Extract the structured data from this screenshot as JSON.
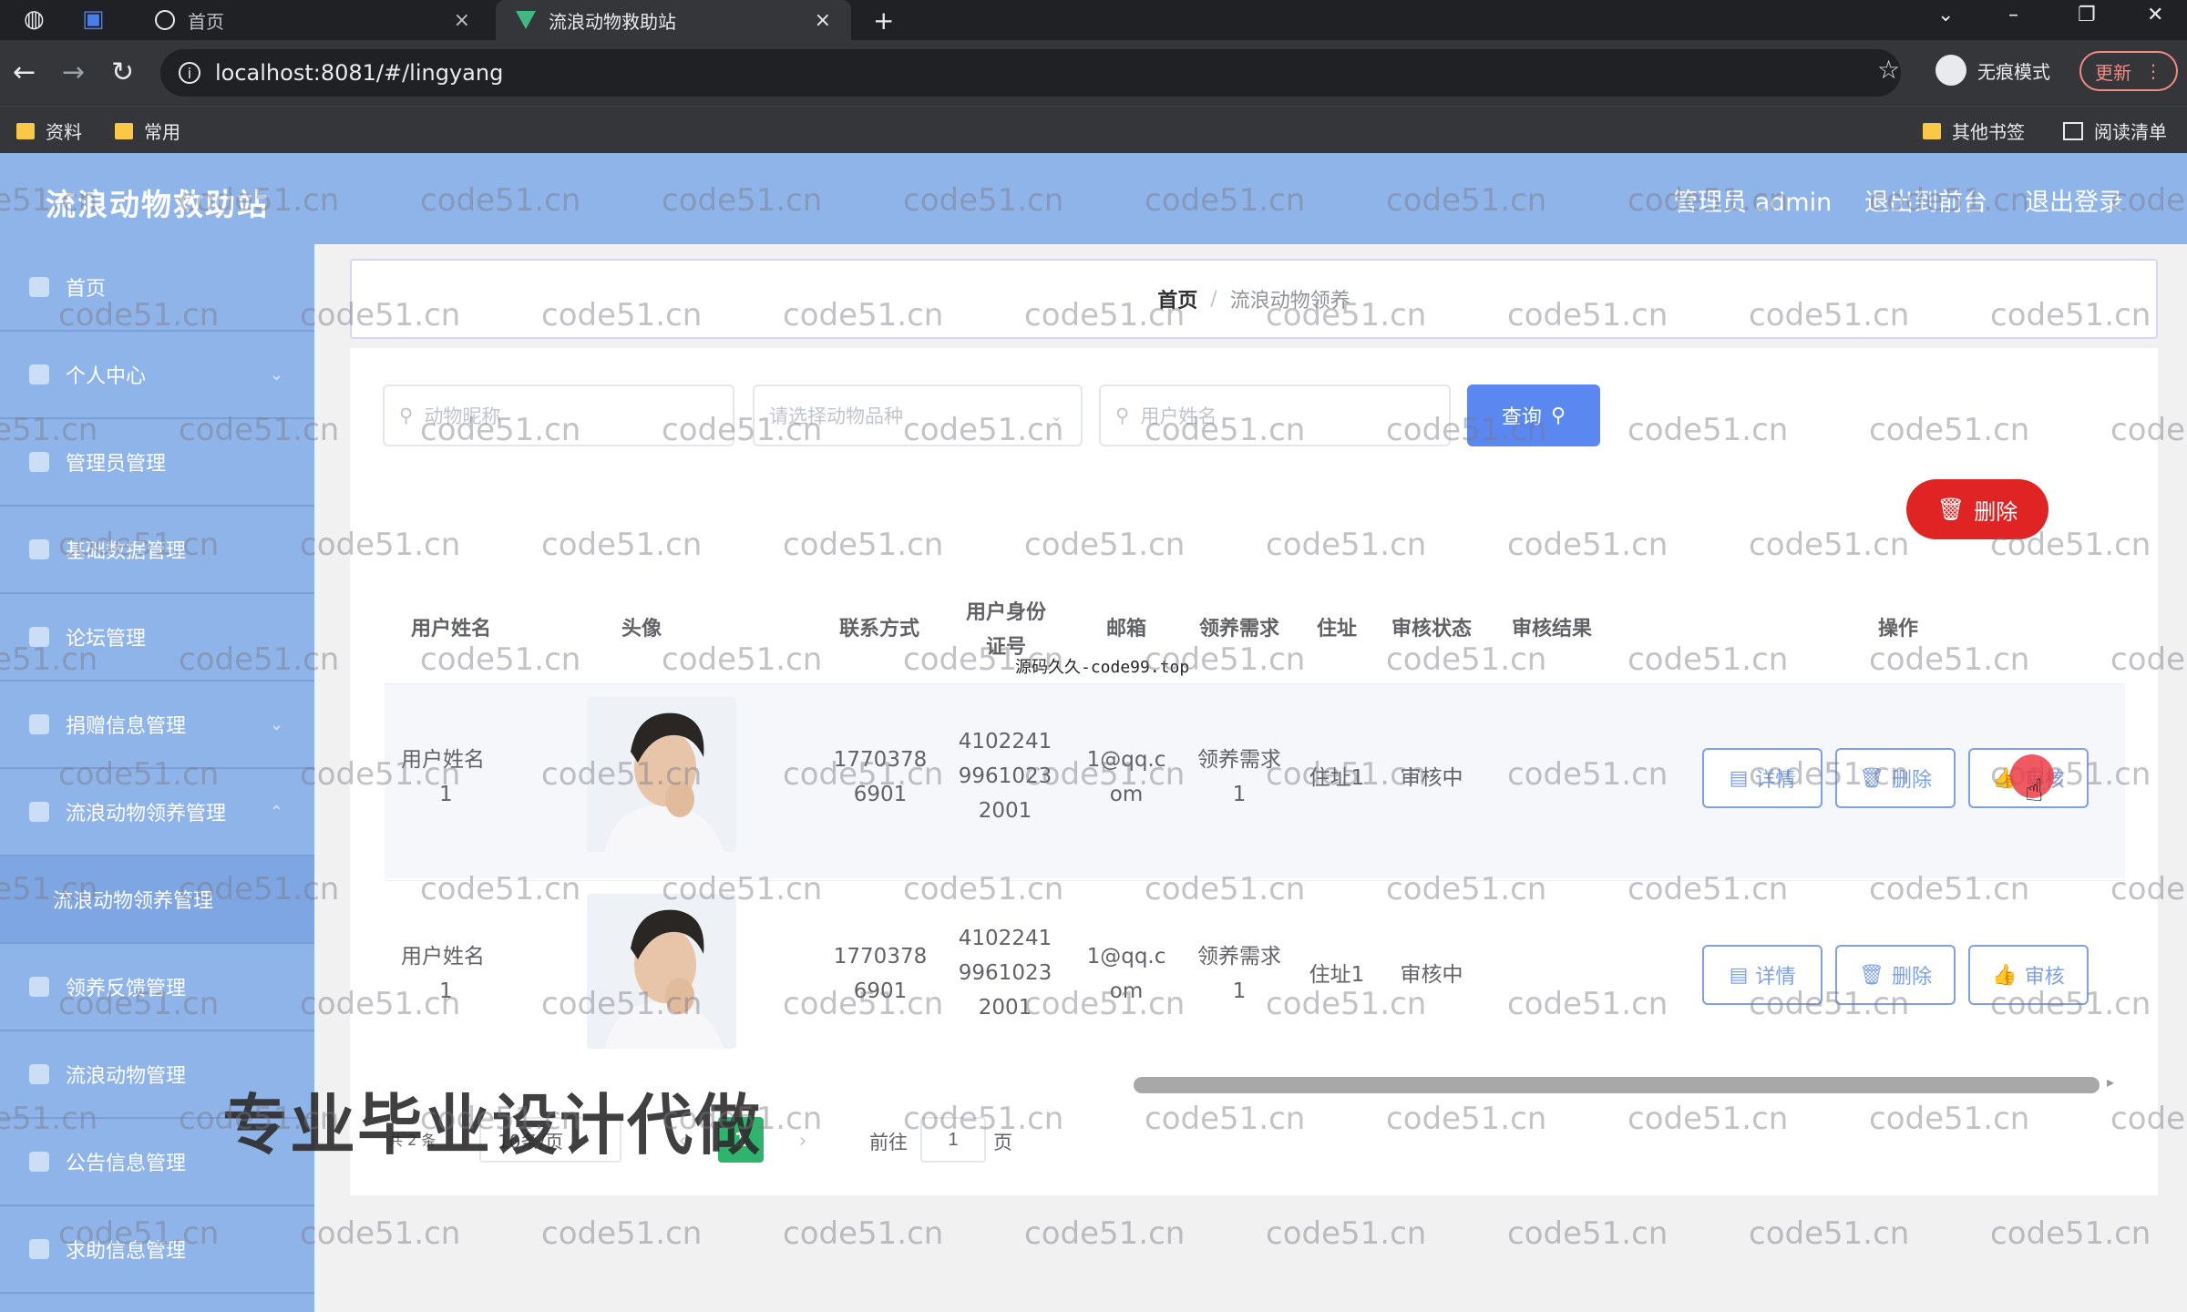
{
  "browser": {
    "tabs": [
      {
        "label": "首页"
      },
      {
        "label": "流浪动物救助站"
      }
    ],
    "close_glyph": "×",
    "new_tab_glyph": "+",
    "url": "localhost:8081/#/lingyang",
    "incognito_label": "无痕模式",
    "update_label": "更新",
    "bookmarks": [
      "资料",
      "常用"
    ],
    "bookmarks_right": [
      "其他书签",
      "阅读清单"
    ]
  },
  "header": {
    "brand": "流浪动物救助站",
    "admin_label": "管理员 admin",
    "exit_frontend": "退出到前台",
    "logout": "退出登录"
  },
  "sidebar": {
    "items": [
      {
        "label": "首页",
        "icon": "home-icon"
      },
      {
        "label": "个人中心",
        "icon": "user-icon"
      },
      {
        "label": "管理员管理",
        "icon": "admin-icon"
      },
      {
        "label": "基础数据管理",
        "icon": "list-icon"
      },
      {
        "label": "论坛管理",
        "icon": "forum-icon"
      },
      {
        "label": "捐赠信息管理",
        "icon": "donate-icon"
      },
      {
        "label": "流浪动物领养管理",
        "icon": "adopt-icon"
      },
      {
        "label": "流浪动物领养管理",
        "icon": ""
      },
      {
        "label": "领养反馈管理",
        "icon": "feedback-icon"
      },
      {
        "label": "流浪动物管理",
        "icon": "animal-icon"
      },
      {
        "label": "公告信息管理",
        "icon": "notice-icon"
      },
      {
        "label": "求助信息管理",
        "icon": "help-icon"
      }
    ]
  },
  "breadcrumb": {
    "home": "首页",
    "separator": "/",
    "current": "流浪动物领养"
  },
  "search": {
    "animal_name_placeholder": "动物昵称",
    "breed_placeholder": "请选择动物品种",
    "user_name_placeholder": "用户姓名",
    "query_label": "查询"
  },
  "toolbar": {
    "delete_label": "删除"
  },
  "table": {
    "headers": [
      "用户姓名",
      "头像",
      "联系方式",
      "用户身份证号",
      "邮箱",
      "领养需求",
      "住址",
      "审核状态",
      "审核结果",
      "操作"
    ],
    "header_id_line1": "用户身份",
    "header_id_line2": "证号",
    "rows": [
      {
        "name_l1": "用户姓名",
        "name_l2": "1",
        "phone_l1": "1770378",
        "phone_l2": "6901",
        "id_l1": "4102241",
        "id_l2": "9961023",
        "id_l3": "2001",
        "email_l1": "1@qq.c",
        "email_l2": "om",
        "need_l1": "领养需求",
        "need_l2": "1",
        "address": "住址1",
        "status": "审核中",
        "result": ""
      },
      {
        "name_l1": "用户姓名",
        "name_l2": "1",
        "phone_l1": "1770378",
        "phone_l2": "6901",
        "id_l1": "4102241",
        "id_l2": "9961023",
        "id_l3": "2001",
        "email_l1": "1@qq.c",
        "email_l2": "om",
        "need_l1": "领养需求",
        "need_l2": "1",
        "address": "住址1",
        "status": "审核中",
        "result": ""
      }
    ],
    "actions": {
      "detail": "详情",
      "delete": "删除",
      "review": "审核"
    }
  },
  "pagination": {
    "total": "共 2 条",
    "page_size": "10条/页",
    "current_page": "1",
    "goto_label": "前往",
    "goto_value": "1",
    "page_unit": "页"
  },
  "overlay": {
    "promo_text": "专业毕业设计代做",
    "source_text": "源码久久-code99.top",
    "watermark": "code51.cn"
  },
  "colors": {
    "header_bg": "#8fb4ea",
    "primary": "#5b87f0",
    "danger": "#e02424",
    "page_active": "#2fb46e"
  }
}
